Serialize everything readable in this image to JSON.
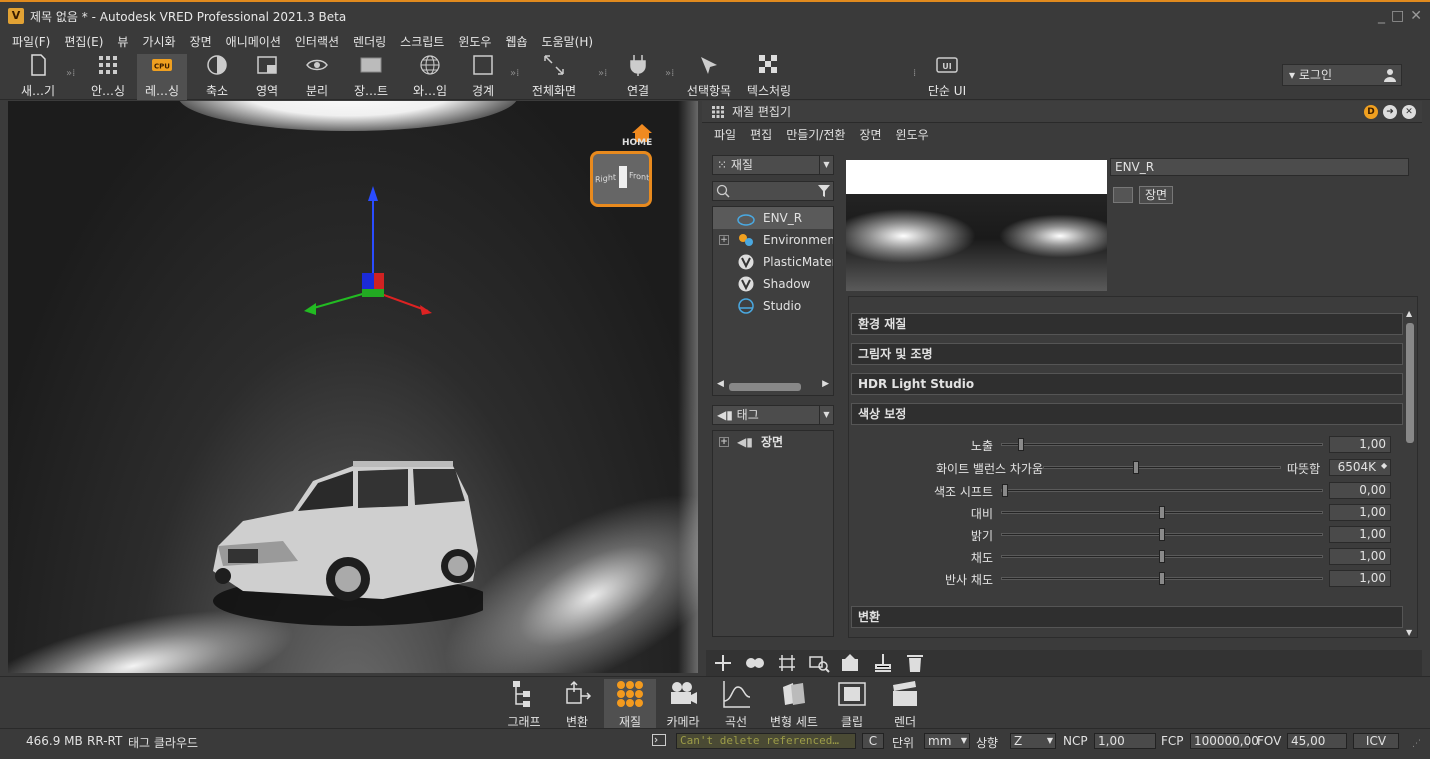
{
  "window": {
    "title": "제목 없음 * - Autodesk VRED Professional 2021.3 Beta",
    "logo": "V"
  },
  "menubar": [
    "파일(F)",
    "편집(E)",
    "뷰",
    "가시화",
    "장면",
    "애니메이션",
    "인터랙션",
    "렌더링",
    "스크립트",
    "윈도우",
    "웹숍",
    "도움말(H)"
  ],
  "toolbar": {
    "items": [
      "새…기",
      "안…싱",
      "레…싱",
      "축소",
      "영역",
      "분리",
      "장…트",
      "와…임",
      "경계",
      "전체화면",
      "연결",
      "선택항목",
      "텍스처링",
      "단순 UI"
    ],
    "cpu_badge": "CPU",
    "simple_ui_badge": "UI",
    "login": "로그인"
  },
  "viewport": {
    "navcube": {
      "home": "HOME",
      "right": "Right",
      "front": "Front"
    }
  },
  "material_editor": {
    "title": "재질 편집기",
    "menu": [
      "파일",
      "편집",
      "만들기/전환",
      "장면",
      "윈도우"
    ],
    "filter_combo": "재질",
    "search_placeholder": "",
    "tree": [
      "ENV_R",
      "Environments",
      "PlasticMateria",
      "Shadow",
      "Studio"
    ],
    "tag_combo": "태그",
    "tag_tree": [
      "장면"
    ],
    "material_name": "ENV_R",
    "tag_chip": "장면",
    "sections": [
      "환경 재질",
      "그림자 및 조명",
      "HDR Light Studio",
      "색상 보정",
      "변환"
    ],
    "props": [
      {
        "label": "노출",
        "value": "1,00",
        "knob": 0.06
      },
      {
        "label": "화이트 밸런스  차가움",
        "value": "6504K",
        "knob": 0.39,
        "right_label": "따뜻함"
      },
      {
        "label": "색조 시프트",
        "value": "0,00",
        "knob": 0.0
      },
      {
        "label": "대비",
        "value": "1,00",
        "knob": 0.5
      },
      {
        "label": "밝기",
        "value": "1,00",
        "knob": 0.5
      },
      {
        "label": "채도",
        "value": "1,00",
        "knob": 0.5
      },
      {
        "label": "반사 채도",
        "value": "1,00",
        "knob": 0.5
      }
    ]
  },
  "dock": [
    "그래프",
    "변환",
    "재질",
    "카메라",
    "곡선",
    "변형 세트",
    "클립",
    "렌더"
  ],
  "status": {
    "memory": "466.9 MB",
    "mode": "RR-RT",
    "cloud": "태그 클라우드",
    "message": "Can't delete referenced…",
    "c_btn": "C",
    "unit_label": "단위",
    "unit": "mm",
    "up_label": "상향",
    "up": "Z",
    "ncp_label": "NCP",
    "ncp": "1,00",
    "fcp_label": "FCP",
    "fcp": "100000,00",
    "fov_label": "FOV",
    "fov": "45,00",
    "icv": "ICV"
  },
  "colors": {
    "accent": "#e08a1e",
    "bg": "#3a3a3a"
  }
}
